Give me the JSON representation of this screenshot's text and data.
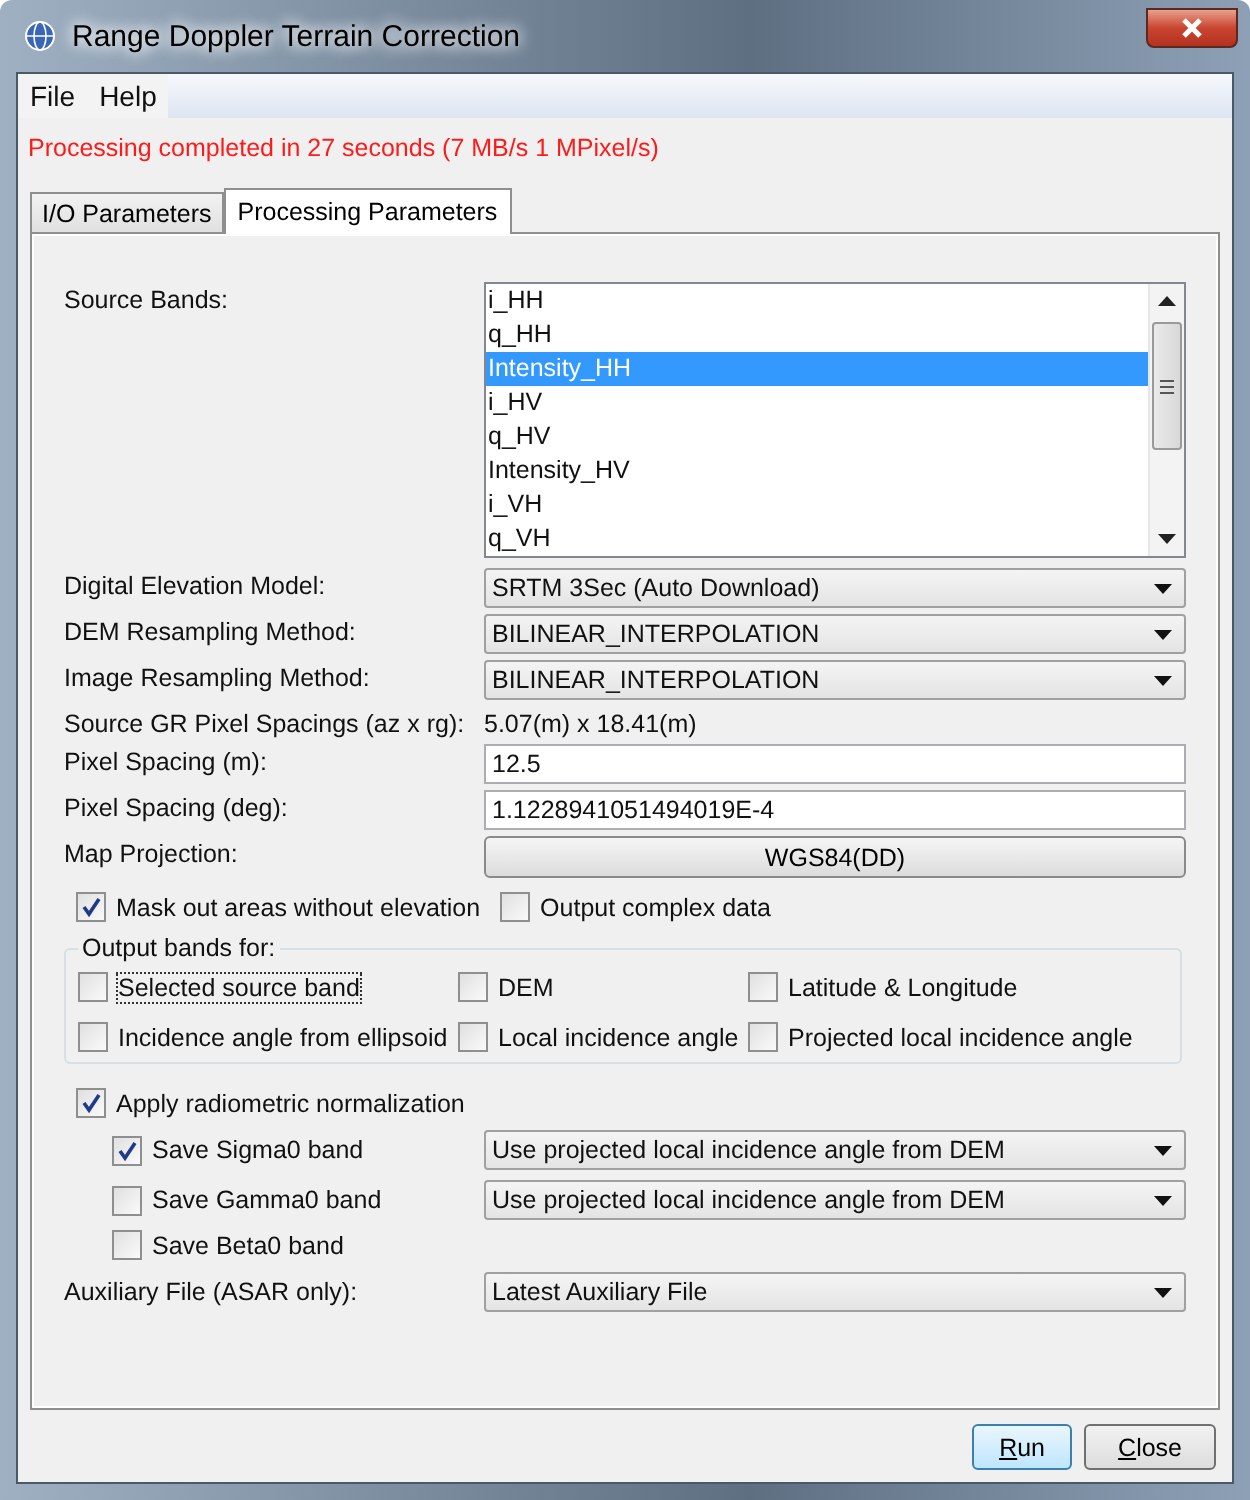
{
  "window": {
    "title": "Range Doppler Terrain Correction"
  },
  "menu": [
    "File",
    "Help"
  ],
  "status_message": "Processing completed in 27 seconds (7 MB/s 1 MPixel/s)",
  "tabs": [
    {
      "label": "I/O Parameters",
      "selected": false
    },
    {
      "label": "Processing Parameters",
      "selected": true
    }
  ],
  "source_bands": {
    "label": "Source Bands:",
    "items": [
      {
        "label": "i_HH",
        "selected": false
      },
      {
        "label": "q_HH",
        "selected": false
      },
      {
        "label": "Intensity_HH",
        "selected": true
      },
      {
        "label": "i_HV",
        "selected": false
      },
      {
        "label": "q_HV",
        "selected": false
      },
      {
        "label": "Intensity_HV",
        "selected": false
      },
      {
        "label": "i_VH",
        "selected": false
      },
      {
        "label": "q_VH",
        "selected": false
      }
    ]
  },
  "fields": [
    {
      "kind": "dropdown",
      "label": "Digital Elevation Model:",
      "value": "SRTM 3Sec (Auto Download)"
    },
    {
      "kind": "dropdown",
      "label": "DEM Resampling Method:",
      "value": "BILINEAR_INTERPOLATION"
    },
    {
      "kind": "dropdown",
      "label": "Image Resampling Method:",
      "value": "BILINEAR_INTERPOLATION"
    },
    {
      "kind": "text",
      "label": "Source GR Pixel Spacings (az x rg):",
      "value": "5.07(m) x 18.41(m)"
    },
    {
      "kind": "input",
      "label": "Pixel Spacing (m):",
      "value": "12.5"
    },
    {
      "kind": "input",
      "label": "Pixel Spacing (deg):",
      "value": "1.1228941051494019E-4"
    },
    {
      "kind": "button",
      "label": "Map Projection:",
      "value": "WGS84(DD)"
    }
  ],
  "options": [
    {
      "label": "Mask out areas without elevation",
      "checked": true
    },
    {
      "label": "Output complex data",
      "checked": false
    }
  ],
  "output_bands": {
    "title": "Output bands for:",
    "items": [
      {
        "label": "Selected source band",
        "checked": false,
        "focused": true
      },
      {
        "label": "DEM",
        "checked": false,
        "focused": false
      },
      {
        "label": "Latitude & Longitude",
        "checked": false,
        "focused": false
      },
      {
        "label": "Incidence angle from ellipsoid",
        "checked": false,
        "focused": false
      },
      {
        "label": "Local incidence angle",
        "checked": false,
        "focused": false
      },
      {
        "label": "Projected local incidence angle",
        "checked": false,
        "focused": false
      }
    ]
  },
  "radiometric": {
    "label": "Apply radiometric normalization",
    "checked": true,
    "bands": [
      {
        "label": "Save Sigma0 band",
        "checked": true,
        "method": "Use projected local incidence angle from DEM"
      },
      {
        "label": "Save Gamma0 band",
        "checked": false,
        "method": "Use projected local incidence angle from DEM"
      },
      {
        "label": "Save Beta0 band",
        "checked": false
      }
    ]
  },
  "auxiliary_file": {
    "label": "Auxiliary File (ASAR only):",
    "value": "Latest Auxiliary File"
  },
  "buttons": [
    {
      "label": "Run",
      "default": true
    },
    {
      "label": "Close",
      "default": false
    }
  ]
}
